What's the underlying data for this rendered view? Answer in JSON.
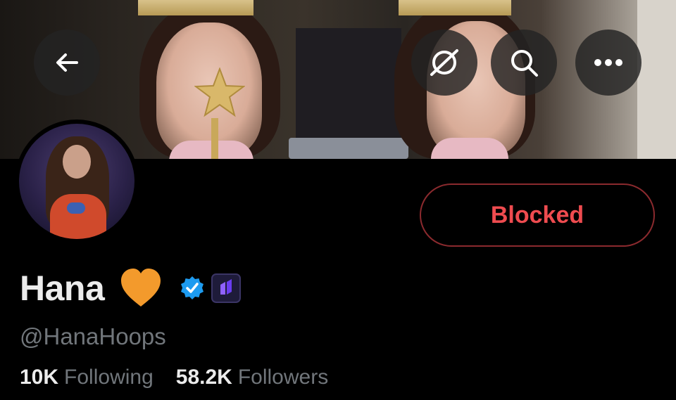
{
  "header": {
    "back_icon": "arrow-left-icon",
    "hide_icon": "eye-slash-icon",
    "search_icon": "search-icon",
    "more_icon": "ellipsis-icon"
  },
  "profile": {
    "name": "Hana",
    "name_emoji": "orange-heart",
    "verified_badge": "verified-blue-checkmark",
    "affiliate_badge": "affiliate-badge",
    "handle": "@HanaHoops",
    "action_button": "Blocked",
    "following_count": "10K",
    "following_label": "Following",
    "followers_count": "58.2K",
    "followers_label": "Followers"
  },
  "colors": {
    "background": "#000000",
    "blocked_text": "#ee4b4f",
    "blocked_border": "#8b2a2e",
    "verified": "#1d9bf0",
    "muted_text": "#71767b"
  }
}
